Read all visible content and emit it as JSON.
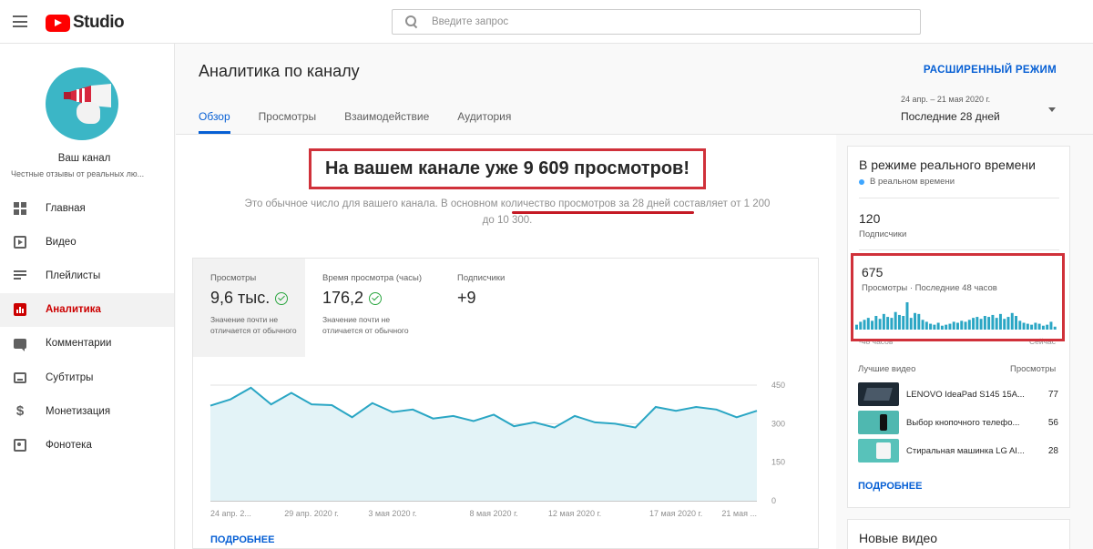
{
  "app": {
    "logo_text": "Studio"
  },
  "search": {
    "placeholder": "Введите запрос"
  },
  "channel": {
    "name": "Ваш канал",
    "description": "Честные отзывы от реальных лю..."
  },
  "nav": [
    {
      "label": "Главная",
      "icon": "dashboard-icon"
    },
    {
      "label": "Видео",
      "icon": "video-icon"
    },
    {
      "label": "Плейлисты",
      "icon": "playlist-icon"
    },
    {
      "label": "Аналитика",
      "icon": "analytics-icon",
      "active": true
    },
    {
      "label": "Комментарии",
      "icon": "comment-icon"
    },
    {
      "label": "Субтитры",
      "icon": "subtitles-icon"
    },
    {
      "label": "Монетизация",
      "icon": "monetization-icon"
    },
    {
      "label": "Фонотека",
      "icon": "audio-library-icon"
    }
  ],
  "header": {
    "title": "Аналитика по каналу",
    "advanced_mode": "РАСШИРЕННЫЙ РЕЖИМ",
    "date_range": "24 апр. – 21 мая 2020 г.",
    "date_label": "Последние 28 дней"
  },
  "tabs": [
    {
      "label": "Обзор",
      "active": true
    },
    {
      "label": "Просмотры"
    },
    {
      "label": "Взаимодействие"
    },
    {
      "label": "Аудитория"
    }
  ],
  "overview": {
    "headline": "На вашем канале уже 9 609 просмотров!",
    "subline": "Это обычное число для вашего канала. В основном количество просмотров за 28 дней составляет от 1 200 до 10 300."
  },
  "metrics": [
    {
      "label": "Просмотры",
      "value": "9,6 тыс.",
      "note": "Значение почти не отличается от обычного",
      "check": true
    },
    {
      "label": "Время просмотра (часы)",
      "value": "176,2",
      "note": "Значение почти не отличается от обычного",
      "check": true
    },
    {
      "label": "Подписчики",
      "value": "+9",
      "note": "",
      "check": false
    }
  ],
  "chart_data": {
    "type": "area",
    "x_tick_labels": [
      "24 апр. 2...",
      "29 апр. 2020 г.",
      "3 мая 2020 г.",
      "8 мая 2020 г.",
      "12 мая 2020 г.",
      "17 мая 2020 г.",
      "21 мая ..."
    ],
    "y_tick_labels": [
      "450",
      "300",
      "150",
      "0"
    ],
    "ylim": [
      0,
      450
    ],
    "values": [
      370,
      395,
      440,
      375,
      420,
      375,
      372,
      325,
      380,
      345,
      355,
      320,
      330,
      310,
      335,
      290,
      305,
      285,
      330,
      305,
      300,
      285,
      365,
      350,
      365,
      355,
      325,
      350
    ],
    "series_color": "#2aa6c4"
  },
  "overview_more": "ПОДРОБНЕЕ",
  "realtime": {
    "title": "В режиме реального времени",
    "live_label": "В реальном времени",
    "subscribers_value": "120",
    "subscribers_label": "Подписчики",
    "views_value": "675",
    "views_label": "Просмотры · Последние 48 часов",
    "bars": [
      5,
      8,
      10,
      12,
      9,
      14,
      11,
      16,
      13,
      12,
      18,
      15,
      14,
      28,
      12,
      17,
      16,
      10,
      8,
      6,
      5,
      7,
      4,
      5,
      6,
      8,
      7,
      9,
      8,
      10,
      12,
      13,
      11,
      14,
      13,
      15,
      12,
      16,
      11,
      13,
      17,
      14,
      9,
      7,
      6,
      5,
      7,
      6,
      4,
      5,
      8,
      3
    ],
    "axis_left": "-48 часов",
    "axis_right": "Сейчас",
    "best_videos_header": "Лучшие видео",
    "views_header": "Просмотры",
    "top_videos": [
      {
        "title": "LENOVO IdeaPad S145 15A...",
        "views": "77"
      },
      {
        "title": "Выбор кнопочного телефо...",
        "views": "56"
      },
      {
        "title": "Стиральная машинка LG AI...",
        "views": "28"
      }
    ],
    "more": "ПОДРОБНЕЕ"
  },
  "new_videos": {
    "title": "Новые видео"
  }
}
